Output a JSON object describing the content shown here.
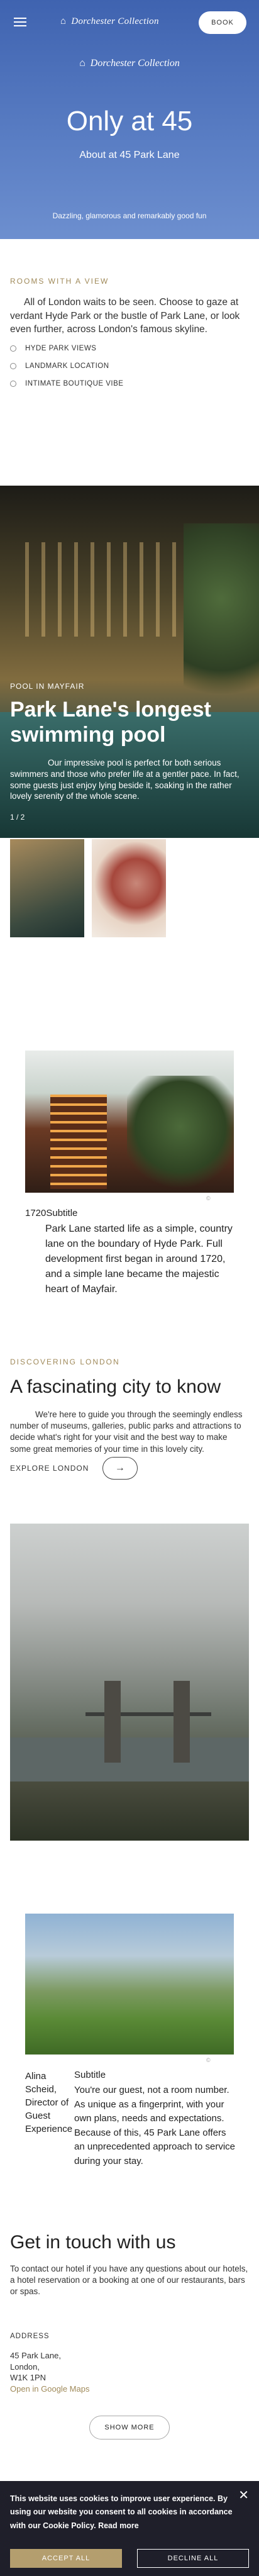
{
  "header": {
    "brand": "Dorchester Collection",
    "book_label": "BOOK"
  },
  "hero": {
    "brand": "Dorchester Collection",
    "title": "Only at 45",
    "subtitle": "About at 45 Park Lane",
    "tagline": "Dazzling, glamorous and remarkably good fun"
  },
  "rooms": {
    "label": "ROOMS WITH A VIEW",
    "text": "All of London waits to be seen. Choose to gaze at verdant Hyde Park or the bustle of Park Lane, or look even further, across London's famous skyline.",
    "features": [
      "HYDE PARK VIEWS",
      "LANDMARK LOCATION",
      "INTIMATE BOUTIQUE VIBE"
    ]
  },
  "pool": {
    "eyebrow": "POOL IN MAYFAIR",
    "title": "Park Lane's longest swimming pool",
    "text": "Our impressive pool is perfect for both serious swimmers and those who prefer life at a gentler pace. In fact, some guests just enjoy lying beside it, soaking in the rather lovely serenity of the whole scene.",
    "pager": "1 / 2"
  },
  "history": {
    "caption": "©",
    "label": "1720Subtitle",
    "text": "Park Lane started life as a simple, country lane on the boundary of Hyde Park. Full development first began in around 1720, and a simple lane became the majestic heart of Mayfair."
  },
  "discover": {
    "label": "DISCOVERING LONDON",
    "title": "A fascinating city to know",
    "text": "We're here to guide you through the seemingly endless number of museums, galleries, public parks and attractions to decide what's right for your visit and the best way to make some great memories of your time in this lovely city.",
    "explore_label": "EXPLORE LONDON",
    "arrow": "→"
  },
  "quote": {
    "caption": "©",
    "author": "Alina Scheid, Director of Guest Experience",
    "subtitle": "Subtitle",
    "text": "You're our guest, not a room number. As unique as a fingerprint, with your own plans, needs and expectations. Because of this, 45 Park Lane offers an unprecedented approach to service during your stay."
  },
  "contact": {
    "title": "Get in touch with us",
    "text": "To contact our hotel if you have any questions about our hotels, a hotel reservation or a booking at one of our restaurants, bars or spas.",
    "address_label": "ADDRESS",
    "address_line1": "45 Park Lane,",
    "address_line2": "London,",
    "address_line3": "W1K 1PN",
    "maps_link": "Open in Google Maps",
    "show_more": "SHOW MORE"
  },
  "cookie": {
    "text": "This website uses cookies to improve user experience. By using our website you consent to all cookies in accordance with our Cookie Policy.",
    "read_more": "Read more",
    "accept": "ACCEPT ALL",
    "decline": "DECLINE ALL",
    "close": "✕"
  }
}
